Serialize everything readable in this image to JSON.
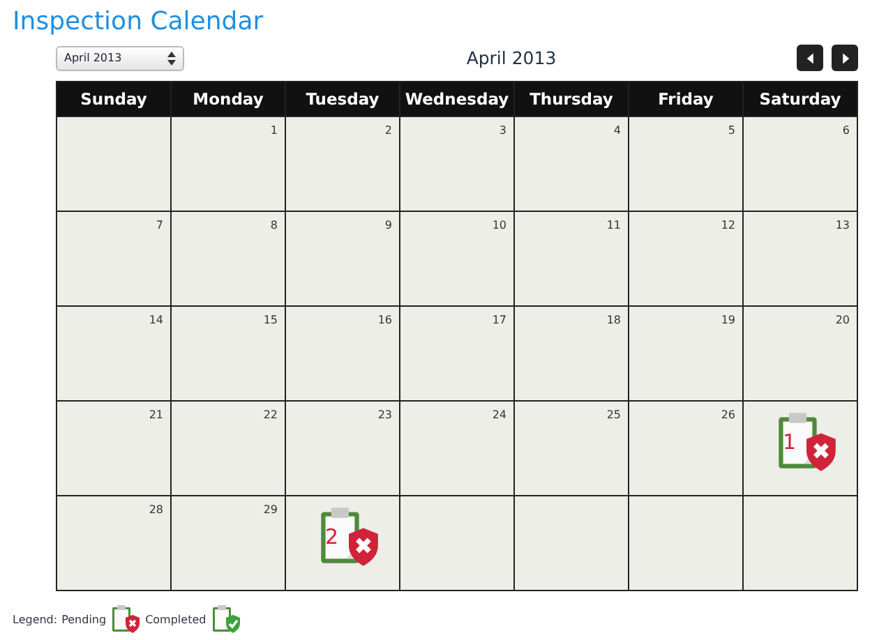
{
  "title": "Inspection Calendar",
  "month_select": {
    "value": "April 2013"
  },
  "month_title": "April 2013",
  "nav_buttons": [
    {
      "kind": "prev"
    },
    {
      "kind": "next"
    }
  ],
  "weekdays": [
    "Sunday",
    "Monday",
    "Tuesday",
    "Wednesday",
    "Thursday",
    "Friday",
    "Saturday"
  ],
  "weeks": [
    [
      {
        "kind": "blank"
      },
      {
        "kind": "day",
        "day": "1"
      },
      {
        "kind": "day",
        "day": "2"
      },
      {
        "kind": "day",
        "day": "3"
      },
      {
        "kind": "day",
        "day": "4"
      },
      {
        "kind": "day",
        "day": "5"
      },
      {
        "kind": "day",
        "day": "6"
      }
    ],
    [
      {
        "kind": "day",
        "day": "7"
      },
      {
        "kind": "day",
        "day": "8"
      },
      {
        "kind": "day",
        "day": "9"
      },
      {
        "kind": "day",
        "day": "10"
      },
      {
        "kind": "day",
        "day": "11"
      },
      {
        "kind": "day",
        "day": "12"
      },
      {
        "kind": "day",
        "day": "13"
      }
    ],
    [
      {
        "kind": "day",
        "day": "14"
      },
      {
        "kind": "day",
        "day": "15"
      },
      {
        "kind": "day",
        "day": "16"
      },
      {
        "kind": "day",
        "day": "17"
      },
      {
        "kind": "day",
        "day": "18"
      },
      {
        "kind": "day",
        "day": "19"
      },
      {
        "kind": "day",
        "day": "20"
      }
    ],
    [
      {
        "kind": "day",
        "day": "21"
      },
      {
        "kind": "day",
        "day": "22"
      },
      {
        "kind": "day",
        "day": "23"
      },
      {
        "kind": "day",
        "day": "24"
      },
      {
        "kind": "day",
        "day": "25"
      },
      {
        "kind": "day",
        "day": "26"
      },
      {
        "kind": "event",
        "event": {
          "kind": "pending",
          "count": "1"
        }
      }
    ],
    [
      {
        "kind": "day",
        "day": "28"
      },
      {
        "kind": "day",
        "day": "29"
      },
      {
        "kind": "event",
        "event": {
          "kind": "pending",
          "count": "2"
        }
      },
      {
        "kind": "blank"
      },
      {
        "kind": "blank"
      },
      {
        "kind": "blank"
      },
      {
        "kind": "blank"
      }
    ]
  ],
  "legend": {
    "label": "Legend:",
    "items": [
      {
        "label": "Pending",
        "kind": "pending"
      },
      {
        "label": "Completed",
        "kind": "completed"
      }
    ]
  }
}
